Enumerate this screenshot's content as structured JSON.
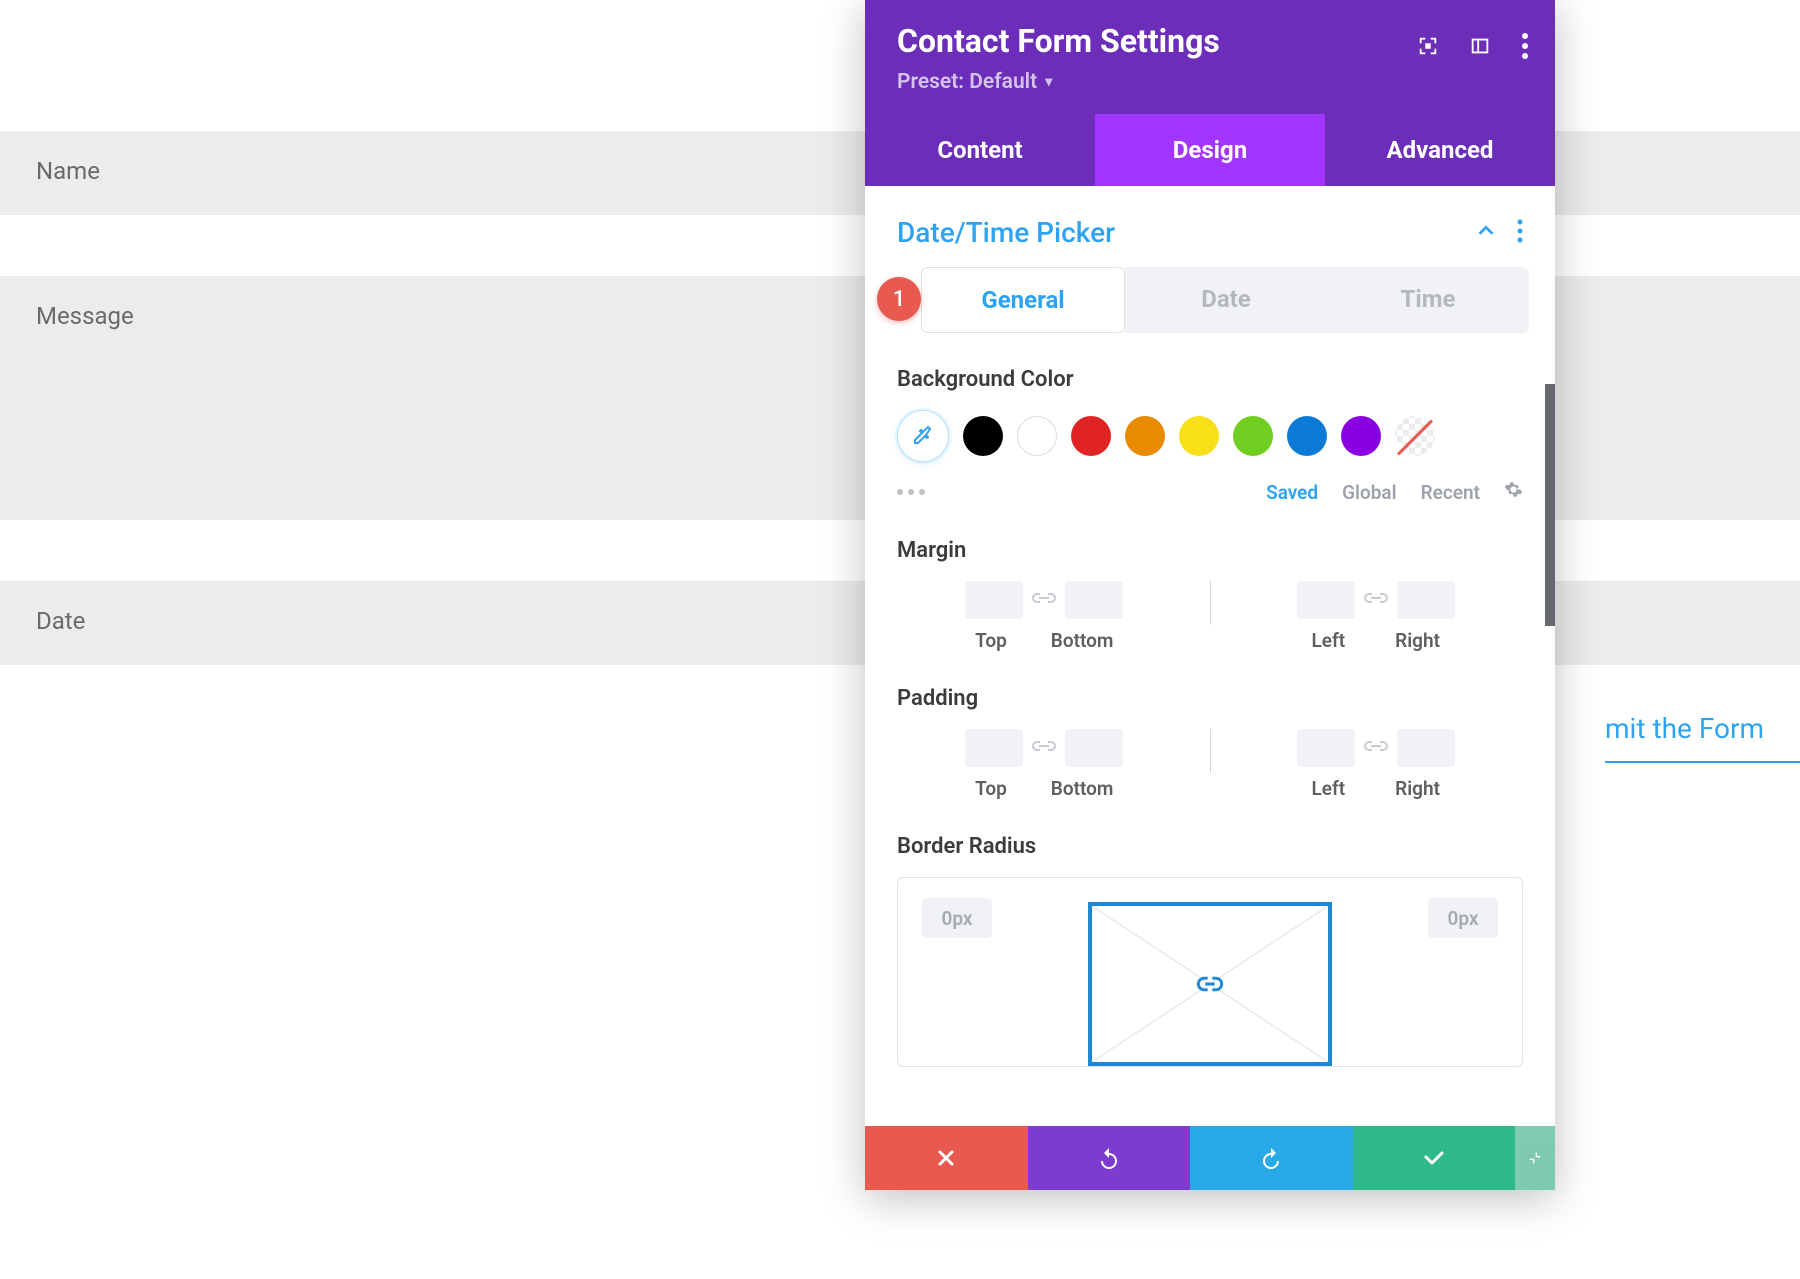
{
  "form": {
    "name_label": "Name",
    "message_label": "Message",
    "date_label": "Date",
    "submit_label": "mit the Form"
  },
  "panel": {
    "title": "Contact Form Settings",
    "preset_label": "Preset: Default",
    "tabs": {
      "content": "Content",
      "design": "Design",
      "advanced": "Advanced"
    },
    "section_title": "Date/Time Picker",
    "badge": "1",
    "subtabs": {
      "general": "General",
      "date": "Date",
      "time": "Time"
    },
    "bg_color_label": "Background Color",
    "palette": {
      "saved": "Saved",
      "global": "Global",
      "recent": "Recent"
    },
    "colors": {
      "black": "#000000",
      "white": "#ffffff",
      "red": "#e02424",
      "orange": "#e88b00",
      "yellow": "#f7e018",
      "green": "#6fce1f",
      "blue": "#0a7ad6",
      "purple": "#8b00e0"
    },
    "margin": {
      "label": "Margin",
      "top": "Top",
      "bottom": "Bottom",
      "left": "Left",
      "right": "Right"
    },
    "padding": {
      "label": "Padding",
      "top": "Top",
      "bottom": "Bottom",
      "left": "Left",
      "right": "Right"
    },
    "border_radius": {
      "label": "Border Radius",
      "tl": "0px",
      "tr": "0px"
    }
  }
}
